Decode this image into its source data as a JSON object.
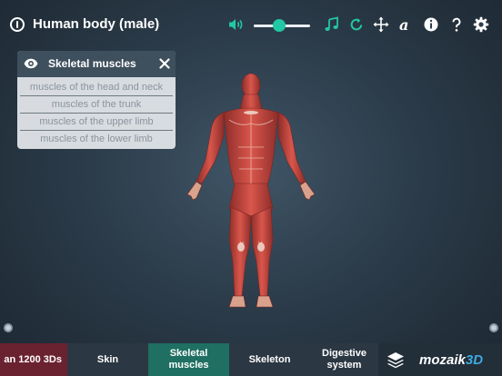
{
  "header": {
    "title": "Human body (male)",
    "volume_level": 0.45
  },
  "icons": {
    "info": "info-circle-icon",
    "volume": "speaker-icon",
    "music": "music-note-icon",
    "reset": "reset-rotate-icon",
    "move": "move-arrows-icon",
    "font": "font-a-icon",
    "details": "info-icon",
    "help": "help-icon",
    "settings": "gear-icon",
    "eye": "eye-icon",
    "close": "close-icon",
    "layers": "layers-icon"
  },
  "colors": {
    "accent": "#22c7a3",
    "active_tab": "#1f6f62",
    "first_tab": "#6b2230",
    "logo_3d": "#3fa9e0"
  },
  "panel": {
    "title": "Skeletal muscles",
    "items": [
      "muscles of the head and neck",
      "muscles of the trunk",
      "muscles of the upper limb",
      "muscles of the lower limb"
    ]
  },
  "bottom": {
    "tabs": [
      "an 1200 3Ds",
      "Skin",
      "Skeletal\nmuscles",
      "Skeleton",
      "Digestive\nsystem"
    ],
    "active_index": 2,
    "logo_main": "mozaik",
    "logo_suffix": "3D"
  }
}
